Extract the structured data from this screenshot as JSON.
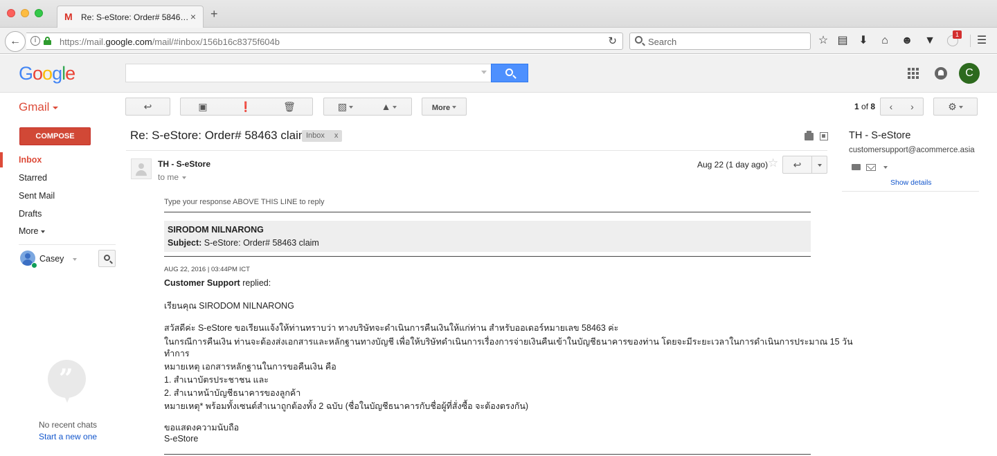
{
  "browser": {
    "tab_title": "Re: S-eStore: Order# 5846…",
    "tab_favicon": "M",
    "tab_close": "×",
    "new_tab": "+",
    "url_prefix": "https://mail.",
    "url_domain": "google.com",
    "url_path": "/mail/#inbox/156b16c8375f604b",
    "search_placeholder": "Search",
    "notification_badge": "1",
    "icons": [
      "back-icon",
      "info-icon",
      "lock-icon",
      "reload-icon",
      "search-icon",
      "bookmark-star-icon",
      "reading-list-icon",
      "download-icon",
      "home-icon",
      "emoji-icon",
      "pocket-icon",
      "ublock-icon",
      "menu-icon"
    ]
  },
  "google": {
    "logo": [
      "G",
      "o",
      "o",
      "g",
      "l",
      "e"
    ],
    "avatar_initial": "C",
    "avatar_color": "#2d6a1e"
  },
  "gmail": {
    "label": "Gmail",
    "toolbar": {
      "more_label": "More",
      "pager_current": "1",
      "pager_of": "of",
      "pager_total": "8"
    },
    "compose_label": "COMPOSE",
    "nav": [
      {
        "label": "Inbox",
        "active": true
      },
      {
        "label": "Starred"
      },
      {
        "label": "Sent Mail"
      },
      {
        "label": "Drafts"
      },
      {
        "label": "More"
      }
    ],
    "hangouts": {
      "user": "Casey",
      "no_recent": "No recent chats",
      "start_new": "Start a new one"
    }
  },
  "message": {
    "subject": "Re: S-eStore: Order# 58463 claim",
    "label_chip": "Inbox",
    "label_close": "x",
    "sender": "TH - S-eStore",
    "to": "to me",
    "date": "Aug 22 (1 day ago)",
    "reply_hint": "Type your response ABOVE THIS LINE to reply",
    "customer_name": "SIRODOM NILNARONG",
    "subject_label": "Subject:",
    "subject_value": "S-eStore: Order# 58463 claim",
    "datetime": "AUG 22, 2016  |  03:44PM ICT",
    "replied_by": "Customer Support",
    "replied_suffix": "replied:",
    "greeting": "เรียนคุณ SIRODOM NILNARONG",
    "lines": [
      "สวัสดีค่ะ S-eStore ขอเรียนแจ้งให้ท่านทราบว่า ทางบริษัทจะดำเนินการคืนเงินให้แก่ท่าน สำหรับออเดอร์หมายเลข 58463 ค่ะ",
      "ในกรณีการคืนเงิน ท่านจะต้องส่งเอกสารและหลักฐานทางบัญชี เพื่อให้บริษัทดำเนินการเรื่องการจ่ายเงินคืนเข้าในบัญชีธนาคารของท่าน โดยจะมีระยะเวลาในการดำเนินการประมาณ 15 วัน",
      "ทำการ",
      "หมายเหตุ เอกสารหลักฐานในการขอคืนเงิน คือ",
      "1. สำเนาบัตรประชาชน และ",
      "2. สำเนาหน้าบัญชีธนาคารของลูกค้า",
      "หมายเหตุ* พร้อมทั้งเซนต์สำเนาถูกต้องทั้ง 2 ฉบับ (ชื่อในบัญชีธนาคารกับชื่อผู้ที่สั่งซื้อ จะต้องตรงกัน)"
    ],
    "closing": "ขอแสดงความนับถือ",
    "signature": "S-eStore"
  },
  "contact": {
    "name": "TH - S-eStore",
    "email": "customersupport@acommerce.asia",
    "show_details": "Show details"
  }
}
